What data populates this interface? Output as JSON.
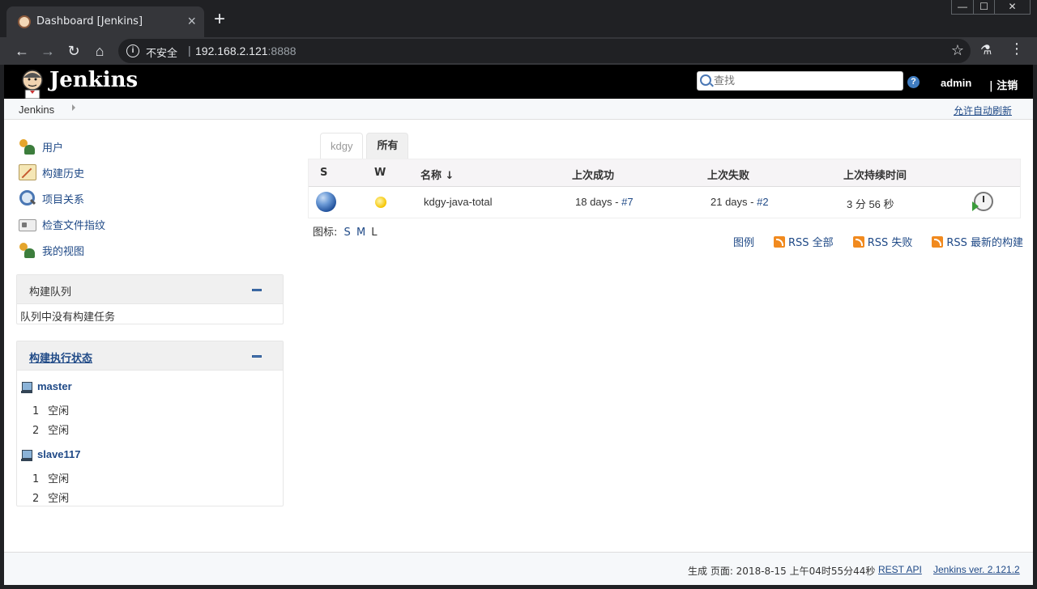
{
  "browser": {
    "tab_title": "Dashboard [Jenkins]",
    "new_tab": "+",
    "insecure_label": "不安全",
    "url_host": "192.168.2.121",
    "url_port": ":8888"
  },
  "header": {
    "brand": "Jenkins",
    "search_placeholder": "查找",
    "help": "?",
    "user": "admin",
    "logout": "| 注销"
  },
  "breadcrumb": {
    "root": "Jenkins",
    "autorefresh": "允许自动刷新"
  },
  "sidebar": {
    "tasks": [
      {
        "label": "用户",
        "icon": "users-icon"
      },
      {
        "label": "构建历史",
        "icon": "history-icon"
      },
      {
        "label": "项目关系",
        "icon": "search-icon"
      },
      {
        "label": "检查文件指纹",
        "icon": "fingerprint-icon"
      },
      {
        "label": "我的视图",
        "icon": "users-icon"
      }
    ],
    "queue": {
      "title": "构建队列",
      "empty": "队列中没有构建任务"
    },
    "executors": {
      "title": "构建执行状态",
      "nodes": [
        {
          "name": "master",
          "executors": [
            {
              "num": "1",
              "state": "空闲"
            },
            {
              "num": "2",
              "state": "空闲"
            }
          ]
        },
        {
          "name": "slave117",
          "executors": [
            {
              "num": "1",
              "state": "空闲"
            },
            {
              "num": "2",
              "state": "空闲"
            }
          ]
        }
      ]
    }
  },
  "main": {
    "tabs": [
      "kdgy",
      "所有"
    ],
    "active_tab": "所有",
    "columns": [
      "S",
      "W",
      "名称 ↓",
      "上次成功",
      "上次失败",
      "上次持续时间"
    ],
    "jobs": [
      {
        "status": "blue",
        "weather": "sunny",
        "name": "kdgy-java-total",
        "last_success_time": "18 days - ",
        "last_success_build": "#7",
        "last_failure_time": "21 days - ",
        "last_failure_build": "#2",
        "last_duration": "3 分 56 秒"
      }
    ],
    "icon_label": "图标:",
    "icon_sizes": {
      "s": "S",
      "m": "M",
      "l": "L"
    },
    "legend": "图例",
    "rss_all": "RSS 全部",
    "rss_failed": "RSS 失败",
    "rss_latest": "RSS 最新的构建"
  },
  "footer": {
    "generated": "生成 页面: 2018-8-15 上午04时55分44秒",
    "rest_api": "REST API",
    "version": "Jenkins ver. 2.121.2"
  },
  "colors": {
    "header_bg": "#000000",
    "link": "#204a87",
    "status_blue": "#3a6fc4",
    "rss_orange": "#f18a1f"
  }
}
